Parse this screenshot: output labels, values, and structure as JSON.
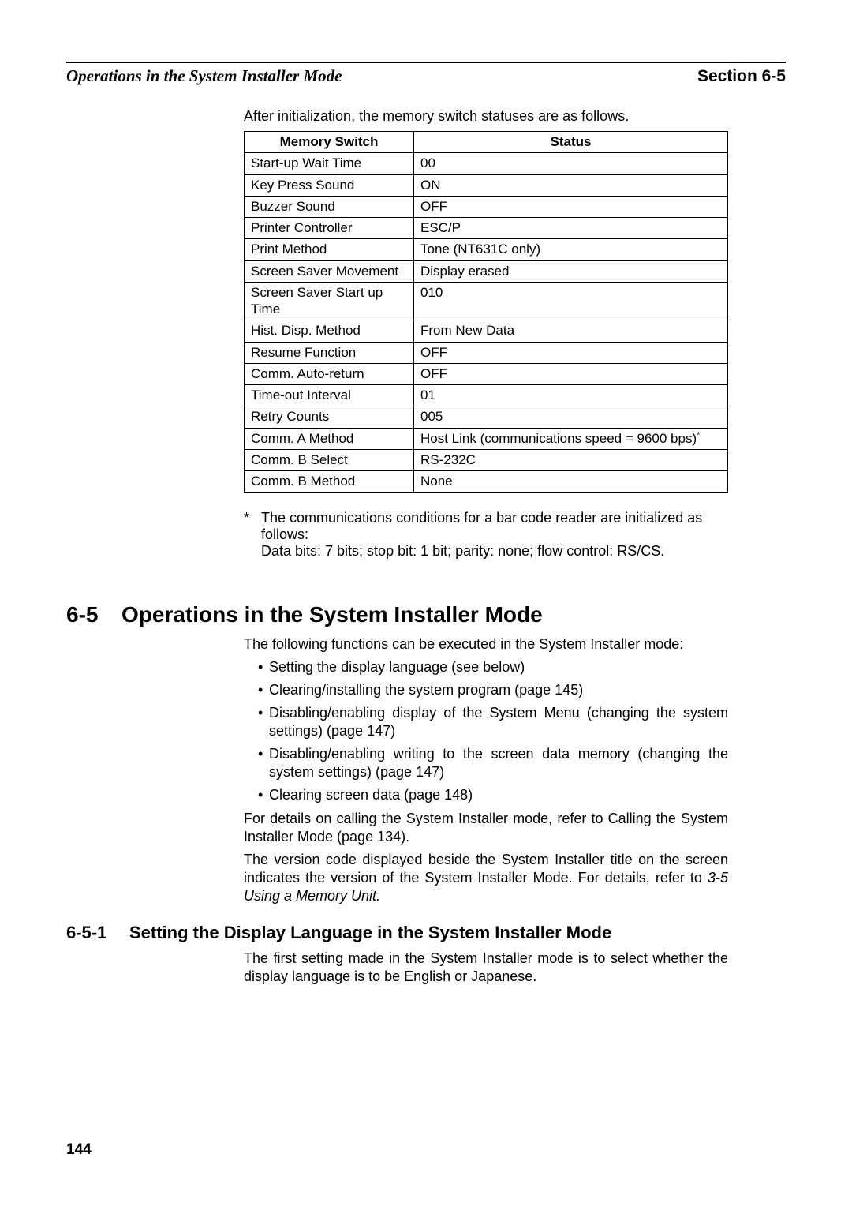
{
  "header": {
    "left": "Operations in the System Installer Mode",
    "right": "Section 6-5"
  },
  "intro": "After initialization, the memory switch statuses are as follows.",
  "table": {
    "head": {
      "c1": "Memory Switch",
      "c2": "Status"
    },
    "rows": [
      {
        "c1": "Start-up Wait Time",
        "c2": "00"
      },
      {
        "c1": "Key Press Sound",
        "c2": "ON"
      },
      {
        "c1": "Buzzer Sound",
        "c2": "OFF"
      },
      {
        "c1": "Printer Controller",
        "c2": "ESC/P"
      },
      {
        "c1": "Print Method",
        "c2": "Tone (NT631C only)"
      },
      {
        "c1": "Screen Saver Movement",
        "c2": "Display erased"
      },
      {
        "c1": "Screen Saver Start up Time",
        "c2": "010"
      },
      {
        "c1": "Hist. Disp. Method",
        "c2": "From New Data"
      },
      {
        "c1": "Resume Function",
        "c2": "OFF"
      },
      {
        "c1": "Comm. Auto-return",
        "c2": "OFF"
      },
      {
        "c1": "Time-out Interval",
        "c2": "01"
      },
      {
        "c1": "Retry Counts",
        "c2": "005"
      },
      {
        "c1": "Comm. A Method",
        "c2": "Host Link (communications speed = 9600 bps)",
        "sup": "*"
      },
      {
        "c1": "Comm. B Select",
        "c2": "RS-232C"
      },
      {
        "c1": "Comm. B Method",
        "c2": "None"
      }
    ]
  },
  "footnote": {
    "mark": "*",
    "line1": "The communications conditions for a bar code reader are initialized as follows:",
    "line2": "Data bits: 7 bits; stop bit: 1 bit; parity: none; flow control: RS/CS."
  },
  "section": {
    "num": "6-5",
    "title": "Operations in the System Installer Mode",
    "p1": "The following functions can be executed in the System Installer mode:",
    "bullets": [
      "Setting the display language (see below)",
      "Clearing/installing the system program (page 145)",
      "Disabling/enabling display of the System Menu (changing the system settings) (page 147)",
      "Disabling/enabling writing to the screen data memory (changing the system settings) (page 147)",
      "Clearing screen data (page 148)"
    ],
    "p2": "For details on calling the System Installer mode, refer to Calling the System Installer Mode (page 134).",
    "p3a": "The version code displayed beside the System Installer title on the screen indicates the version of the System Installer Mode. For details, refer to ",
    "p3b": "3-5 Using a Memory Unit."
  },
  "subsection": {
    "num": "6-5-1",
    "title": "Setting the Display Language in the System Installer Mode",
    "p1": "The first setting made in the System Installer mode is to select whether the display language is to be English or Japanese."
  },
  "page_number": "144"
}
